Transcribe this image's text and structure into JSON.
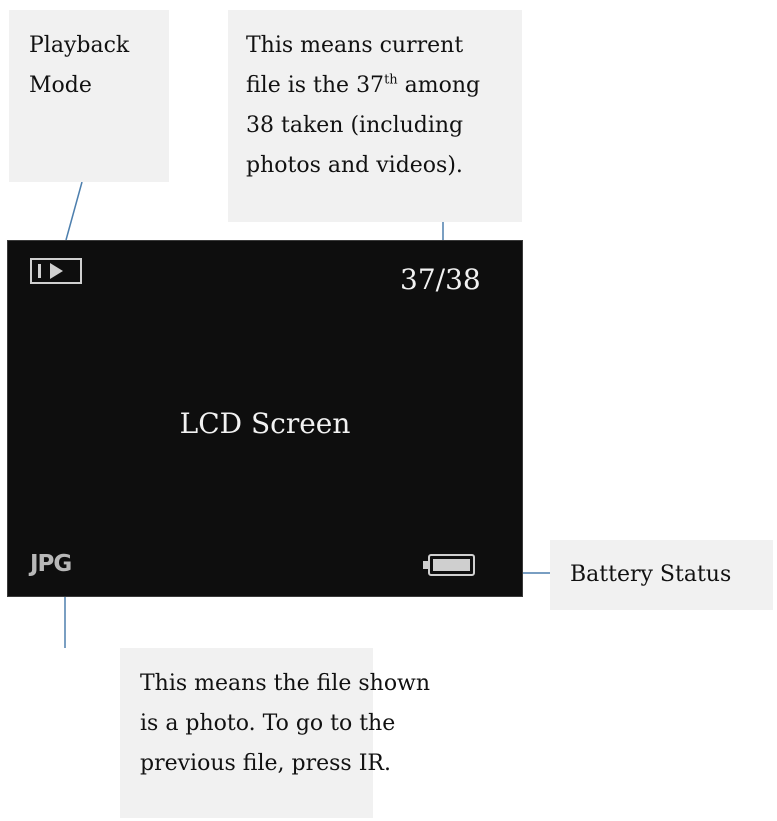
{
  "callouts": {
    "playback": {
      "line1": "Playback",
      "line2": "Mode"
    },
    "count": {
      "line1": "This means current",
      "line2_pre": "file is the 37",
      "line2_sup": "th",
      "line2_post": " among",
      "line3": "38 taken (including",
      "line4": "photos and videos)."
    },
    "battery": {
      "text": "Battery Status"
    },
    "jpg": {
      "line1": "This means the file shown",
      "line2": "is a photo. To go to the",
      "line3": "previous file, press IR."
    }
  },
  "lcd": {
    "counter": "37/38",
    "label": "LCD Screen",
    "format": "JPG",
    "icons": {
      "mode": "playback-icon",
      "battery": "battery-icon"
    }
  },
  "colors": {
    "connector": "#4d7fae",
    "callout_bg": "#f1f1f1",
    "screen_bg": "#0e0e0e"
  }
}
